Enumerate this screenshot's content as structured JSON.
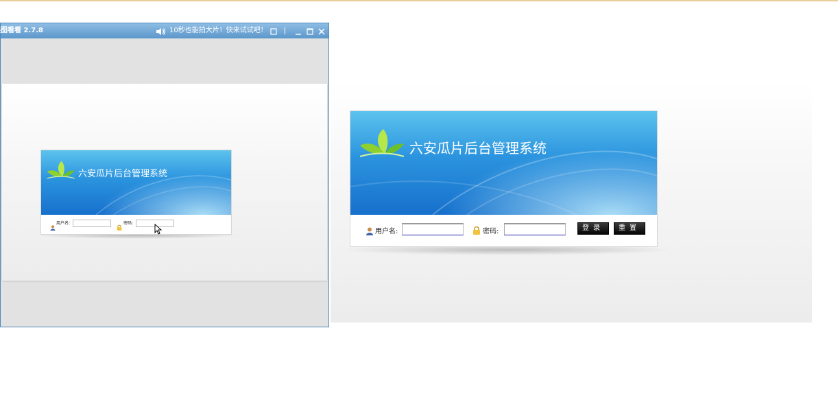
{
  "viewer": {
    "app_title": "美图看看 2.7.8",
    "promo_text": "10秒也能拍大片！快来试试吧！",
    "icons": {
      "speaker": "speaker-icon",
      "fullscreen": "fullscreen-icon",
      "minimize": "minimize-icon",
      "maximize": "maximize-icon",
      "close": "close-icon"
    }
  },
  "login": {
    "system_title": "六安瓜片后台管理系统",
    "username_label": "用户名:",
    "password_label": "密码:",
    "username_value": "",
    "password_value": "",
    "login_button": "登录",
    "reset_button": "重置",
    "icons": {
      "logo": "leaf-logo-icon",
      "user": "user-icon",
      "lock": "lock-icon"
    }
  },
  "colors": {
    "banner_top": "#5cc3ee",
    "banner_bottom": "#1770cc",
    "viewer_titlebar": "#5b97cb",
    "button": "#111111"
  }
}
